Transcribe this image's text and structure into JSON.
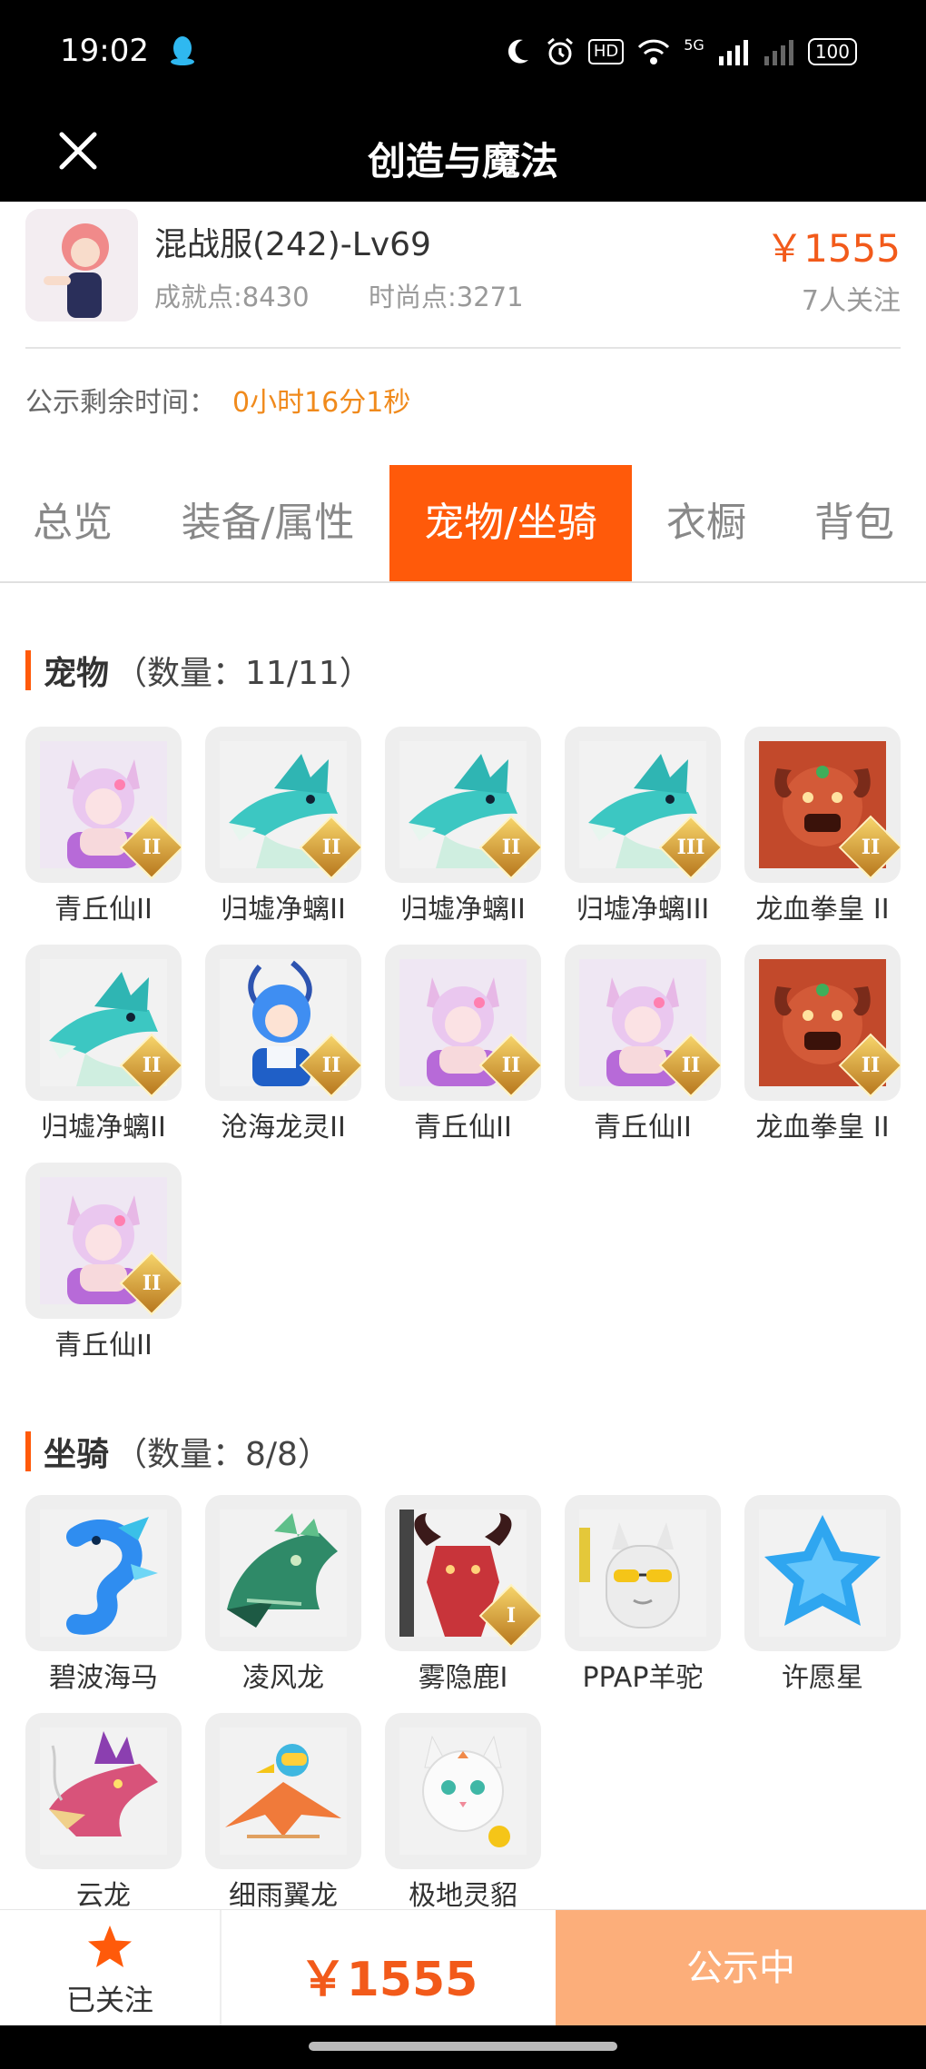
{
  "status_bar": {
    "time": "19:02",
    "battery": "100",
    "hd_label": "HD",
    "network_label": "5G"
  },
  "navbar": {
    "title": "创造与魔法"
  },
  "account": {
    "server_level": "混战服(242)-Lv69",
    "achievement": "成就点:8430",
    "fashion": "时尚点:3271",
    "price": "￥1555",
    "followers": "7人关注",
    "remaining_label": "公示剩余时间：",
    "remaining_value": "0小时16分1秒"
  },
  "tabs": [
    {
      "label": "总览",
      "active": false
    },
    {
      "label": "装备/属性",
      "active": false
    },
    {
      "label": "宠物/坐骑",
      "active": true
    },
    {
      "label": "衣橱",
      "active": false
    },
    {
      "label": "背包",
      "active": false
    }
  ],
  "pets": {
    "title": "宠物",
    "count": "（数量：11/11）",
    "items": [
      {
        "name": "青丘仙II",
        "icon": "fox-girl-icon",
        "grade": "II"
      },
      {
        "name": "归墟净螭II",
        "icon": "cyan-dragon-icon",
        "grade": "II"
      },
      {
        "name": "归墟净螭II",
        "icon": "cyan-dragon-icon",
        "grade": "II"
      },
      {
        "name": "归墟净螭III",
        "icon": "cyan-dragon-icon",
        "grade": "III"
      },
      {
        "name": "龙血拳皇 II",
        "icon": "red-demon-icon",
        "grade": "II"
      },
      {
        "name": "归墟净螭II",
        "icon": "cyan-dragon-icon",
        "grade": "II"
      },
      {
        "name": "沧海龙灵II",
        "icon": "blue-dragon-boy-icon",
        "grade": "II"
      },
      {
        "name": "青丘仙II",
        "icon": "fox-girl-icon",
        "grade": "II"
      },
      {
        "name": "青丘仙II",
        "icon": "fox-girl-icon",
        "grade": "II"
      },
      {
        "name": "龙血拳皇 II",
        "icon": "red-demon-icon",
        "grade": "II"
      },
      {
        "name": "青丘仙II",
        "icon": "fox-girl-icon",
        "grade": "II"
      }
    ]
  },
  "mounts": {
    "title": "坐骑",
    "count": "（数量：8/8）",
    "items": [
      {
        "name": "碧波海马",
        "icon": "seahorse-icon",
        "grade": ""
      },
      {
        "name": "凌风龙",
        "icon": "green-dragon-icon",
        "grade": ""
      },
      {
        "name": "雾隐鹿I",
        "icon": "red-deer-icon",
        "grade": "I"
      },
      {
        "name": "PPAP羊驼",
        "icon": "alpaca-icon",
        "grade": ""
      },
      {
        "name": "许愿星",
        "icon": "blue-star-icon",
        "grade": ""
      },
      {
        "name": "云龙",
        "icon": "cloud-dragon-icon",
        "grade": ""
      },
      {
        "name": "细雨翼龙",
        "icon": "pterosaur-icon",
        "grade": ""
      },
      {
        "name": "极地灵貂",
        "icon": "white-mink-icon",
        "grade": ""
      }
    ]
  },
  "bottom": {
    "follow_label": "已关注",
    "price": "￥1555",
    "status_label": "公示中"
  },
  "colors": {
    "accent": "#ff5a0a",
    "price": "#f25a1a",
    "status_button": "#fcae7a"
  }
}
